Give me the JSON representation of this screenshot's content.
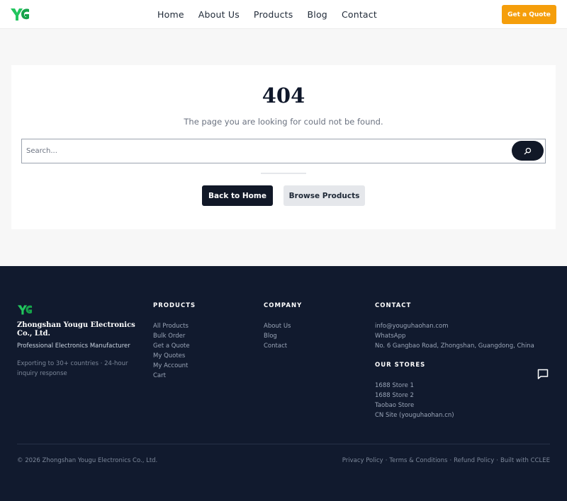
{
  "header": {
    "nav": [
      "Home",
      "About Us",
      "Products",
      "Blog",
      "Contact"
    ],
    "cta_label": "Get a Quote"
  },
  "main": {
    "error_code": "404",
    "message": "The page you are looking for could not be found.",
    "search_placeholder": "Search...",
    "back_home_label": "Back to Home",
    "browse_label": "Browse Products"
  },
  "footer": {
    "company_name": "Zhongshan Yougu Electronics Co., Ltd.",
    "tagline": "Professional Electronics Manufacturer",
    "subtext": "Exporting to 30+ countries · 24-hour inquiry response",
    "products": {
      "heading": "PRODUCTS",
      "items": [
        "All Products",
        "Bulk Order",
        "Get a Quote",
        "My Quotes",
        "My Account",
        "Cart"
      ]
    },
    "company": {
      "heading": "COMPANY",
      "items": [
        "About Us",
        "Blog",
        "Contact"
      ]
    },
    "contact": {
      "heading": "CONTACT",
      "items": [
        "info@youguhaohan.com",
        "WhatsApp",
        "No. 6 Gangbao Road, Zhongshan, Guangdong, China"
      ]
    },
    "stores": {
      "heading": "OUR STORES",
      "items": [
        "1688 Store 1",
        "1688 Store 2",
        "Taobao Store",
        "CN Site (youguhaohan.cn)"
      ]
    },
    "copyright": "© 2026 Zhongshan Yougu Electronics Co., Ltd.",
    "legal": [
      "Privacy Policy",
      "·",
      "Terms & Conditions",
      "·",
      "Refund Policy",
      "·",
      "Built with CCLEE"
    ]
  },
  "colors": {
    "accent": "#f59e0b",
    "logo_green": "#22c55e",
    "dark": "#111827",
    "footer_bg": "#111a2e"
  },
  "icons": {
    "logo": "yg-logo-icon",
    "search": "search-icon",
    "chat": "chat-bubble-icon"
  }
}
